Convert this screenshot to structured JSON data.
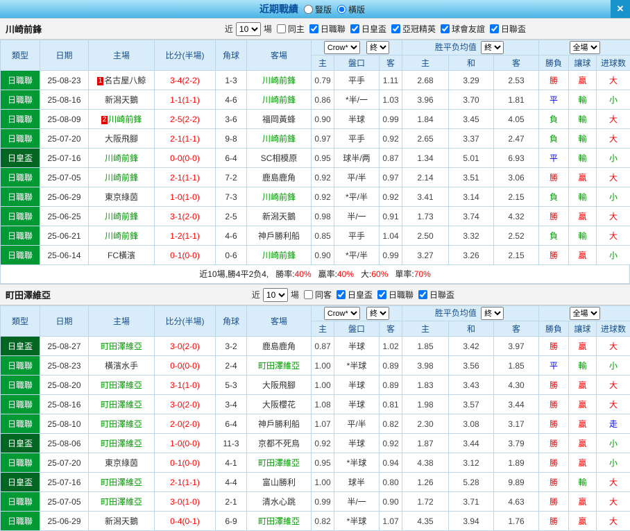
{
  "topbar": {
    "title": "近期戰績",
    "radios": [
      {
        "label": "豎版",
        "selected": false
      },
      {
        "label": "橫版",
        "selected": true
      }
    ],
    "close": "✕"
  },
  "table_header": {
    "type": "類型",
    "date": "日期",
    "home": "主場",
    "score": "比分(半場)",
    "corner": "角球",
    "away": "客場",
    "bookmaker": "Crow*",
    "final": "終",
    "europe": "胜平负均值",
    "fullgame": "全場",
    "ah_sub": [
      "主",
      "盤口",
      "客"
    ],
    "eu_sub": [
      "主",
      "和",
      "客"
    ],
    "res_sub": [
      "勝負",
      "讓球",
      "进球数"
    ]
  },
  "colors": {
    "league_main": "#009933",
    "league_cup": "#006622",
    "win": "#ff0000",
    "draw": "#0000ee",
    "lose": "#009900"
  },
  "sections": [
    {
      "team": "川崎前鋒",
      "filters": {
        "near": "近",
        "count": "10",
        "unit": "場",
        "options": [
          {
            "label": "同主",
            "checked": false
          },
          {
            "label": "日職聯",
            "checked": true
          },
          {
            "label": "日皇盃",
            "checked": true
          },
          {
            "label": "亞冠精英",
            "checked": true
          },
          {
            "label": "球會友誼",
            "checked": true
          },
          {
            "label": "日聯盃",
            "checked": true
          }
        ]
      },
      "rows": [
        {
          "league": "日職聯",
          "date": "25-08-23",
          "home": "名古屋八鯨",
          "home_badge": "1",
          "score": "3-4(2-2)",
          "corner": "1-3",
          "away": "川崎前鋒",
          "ah_home": "0.79",
          "handicap": "平手",
          "ah_away": "1.11",
          "eu_home": "2.68",
          "eu_draw": "3.29",
          "eu_away": "2.53",
          "result": "勝",
          "handicap_result": "贏",
          "goals": "大"
        },
        {
          "league": "日職聯",
          "date": "25-08-16",
          "home": "新潟天鵝",
          "score": "1-1(1-1)",
          "corner": "4-6",
          "away": "川崎前鋒",
          "ah_home": "0.86",
          "handicap": "*半/一",
          "ah_away": "1.03",
          "eu_home": "3.96",
          "eu_draw": "3.70",
          "eu_away": "1.81",
          "result": "平",
          "handicap_result": "輸",
          "goals": "小"
        },
        {
          "league": "日職聯",
          "date": "25-08-09",
          "home": "川崎前鋒",
          "home_badge": "2",
          "score": "2-5(2-2)",
          "corner": "3-6",
          "away": "福岡黃蜂",
          "ah_home": "0.90",
          "handicap": "半球",
          "ah_away": "0.99",
          "eu_home": "1.84",
          "eu_draw": "3.45",
          "eu_away": "4.05",
          "result": "負",
          "handicap_result": "輸",
          "goals": "大"
        },
        {
          "league": "日職聯",
          "date": "25-07-20",
          "home": "大阪飛腳",
          "score": "2-1(1-1)",
          "corner": "9-8",
          "away": "川崎前鋒",
          "ah_home": "0.97",
          "handicap": "平手",
          "ah_away": "0.92",
          "eu_home": "2.65",
          "eu_draw": "3.37",
          "eu_away": "2.47",
          "result": "負",
          "handicap_result": "輸",
          "goals": "大"
        },
        {
          "league": "日皇盃",
          "date": "25-07-16",
          "home": "川崎前鋒",
          "score": "0-0(0-0)",
          "corner": "6-4",
          "away": "SC相模原",
          "ah_home": "0.95",
          "handicap": "球半/两",
          "ah_away": "0.87",
          "eu_home": "1.34",
          "eu_draw": "5.01",
          "eu_away": "6.93",
          "result": "平",
          "handicap_result": "輸",
          "goals": "小"
        },
        {
          "league": "日職聯",
          "date": "25-07-05",
          "home": "川崎前鋒",
          "score": "2-1(1-1)",
          "corner": "7-2",
          "away": "鹿島鹿角",
          "ah_home": "0.92",
          "handicap": "平/半",
          "ah_away": "0.97",
          "eu_home": "2.14",
          "eu_draw": "3.51",
          "eu_away": "3.06",
          "result": "勝",
          "handicap_result": "贏",
          "goals": "大"
        },
        {
          "league": "日職聯",
          "date": "25-06-29",
          "home": "東京綠茵",
          "score": "1-0(1-0)",
          "corner": "7-3",
          "away": "川崎前鋒",
          "ah_home": "0.92",
          "handicap": "*平/半",
          "ah_away": "0.92",
          "eu_home": "3.41",
          "eu_draw": "3.14",
          "eu_away": "2.15",
          "result": "負",
          "handicap_result": "輸",
          "goals": "小"
        },
        {
          "league": "日職聯",
          "date": "25-06-25",
          "home": "川崎前鋒",
          "score": "3-1(2-0)",
          "corner": "2-5",
          "away": "新潟天鵝",
          "ah_home": "0.98",
          "handicap": "半/一",
          "ah_away": "0.91",
          "eu_home": "1.73",
          "eu_draw": "3.74",
          "eu_away": "4.32",
          "result": "勝",
          "handicap_result": "贏",
          "goals": "大"
        },
        {
          "league": "日職聯",
          "date": "25-06-21",
          "home": "川崎前鋒",
          "score": "1-2(1-1)",
          "corner": "4-6",
          "away": "神戶勝利船",
          "ah_home": "0.85",
          "handicap": "平手",
          "ah_away": "1.04",
          "eu_home": "2.50",
          "eu_draw": "3.32",
          "eu_away": "2.52",
          "result": "負",
          "handicap_result": "輸",
          "goals": "大"
        },
        {
          "league": "日職聯",
          "date": "25-06-14",
          "home": "FC橫濱",
          "score": "0-1(0-0)",
          "corner": "0-6",
          "away": "川崎前鋒",
          "ah_home": "0.90",
          "handicap": "*平/半",
          "ah_away": "0.99",
          "eu_home": "3.27",
          "eu_draw": "3.26",
          "eu_away": "2.15",
          "result": "勝",
          "handicap_result": "贏",
          "goals": "小"
        }
      ],
      "summary": {
        "prefix": "近10場,勝4平2负4,",
        "stats": [
          {
            "label": "勝率:",
            "value": "40%"
          },
          {
            "label": "贏率:",
            "value": "40%"
          },
          {
            "label": "大:",
            "value": "60%"
          },
          {
            "label": "單率:",
            "value": "70%"
          }
        ]
      }
    },
    {
      "team": "町田澤維亞",
      "filters": {
        "near": "近",
        "count": "10",
        "unit": "場",
        "options": [
          {
            "label": "同客",
            "checked": false
          },
          {
            "label": "日皇盃",
            "checked": true
          },
          {
            "label": "日職聯",
            "checked": true
          },
          {
            "label": "日聯盃",
            "checked": true
          }
        ]
      },
      "rows": [
        {
          "league": "日皇盃",
          "date": "25-08-27",
          "home": "町田澤維亞",
          "score": "3-0(2-0)",
          "corner": "3-2",
          "away": "鹿島鹿角",
          "ah_home": "0.87",
          "handicap": "半球",
          "ah_away": "1.02",
          "eu_home": "1.85",
          "eu_draw": "3.42",
          "eu_away": "3.97",
          "result": "勝",
          "handicap_result": "贏",
          "goals": "大"
        },
        {
          "league": "日職聯",
          "date": "25-08-23",
          "home": "橫濱水手",
          "score": "0-0(0-0)",
          "corner": "2-4",
          "away": "町田澤維亞",
          "ah_home": "1.00",
          "handicap": "*半球",
          "ah_away": "0.89",
          "eu_home": "3.98",
          "eu_draw": "3.56",
          "eu_away": "1.85",
          "result": "平",
          "handicap_result": "輸",
          "goals": "小"
        },
        {
          "league": "日職聯",
          "date": "25-08-20",
          "home": "町田澤維亞",
          "score": "3-1(1-0)",
          "corner": "5-3",
          "away": "大阪飛腳",
          "ah_home": "1.00",
          "handicap": "半球",
          "ah_away": "0.89",
          "eu_home": "1.83",
          "eu_draw": "3.43",
          "eu_away": "4.30",
          "result": "勝",
          "handicap_result": "贏",
          "goals": "大"
        },
        {
          "league": "日職聯",
          "date": "25-08-16",
          "home": "町田澤維亞",
          "score": "3-0(2-0)",
          "corner": "3-4",
          "away": "大阪櫻花",
          "ah_home": "1.08",
          "handicap": "半球",
          "ah_away": "0.81",
          "eu_home": "1.98",
          "eu_draw": "3.57",
          "eu_away": "3.44",
          "result": "勝",
          "handicap_result": "贏",
          "goals": "大"
        },
        {
          "league": "日職聯",
          "date": "25-08-10",
          "home": "町田澤維亞",
          "score": "2-0(2-0)",
          "corner": "6-4",
          "away": "神戶勝利船",
          "ah_home": "1.07",
          "handicap": "平/半",
          "ah_away": "0.82",
          "eu_home": "2.30",
          "eu_draw": "3.08",
          "eu_away": "3.17",
          "result": "勝",
          "handicap_result": "贏",
          "goals": "走"
        },
        {
          "league": "日皇盃",
          "date": "25-08-06",
          "home": "町田澤維亞",
          "score": "1-0(0-0)",
          "corner": "11-3",
          "away": "京都不死鳥",
          "ah_home": "0.92",
          "handicap": "半球",
          "ah_away": "0.92",
          "eu_home": "1.87",
          "eu_draw": "3.44",
          "eu_away": "3.79",
          "result": "勝",
          "handicap_result": "贏",
          "goals": "小"
        },
        {
          "league": "日職聯",
          "date": "25-07-20",
          "home": "東京綠茵",
          "score": "0-1(0-0)",
          "corner": "4-1",
          "away": "町田澤維亞",
          "ah_home": "0.95",
          "handicap": "*半球",
          "ah_away": "0.94",
          "eu_home": "4.38",
          "eu_draw": "3.12",
          "eu_away": "1.89",
          "result": "勝",
          "handicap_result": "贏",
          "goals": "小"
        },
        {
          "league": "日皇盃",
          "date": "25-07-16",
          "home": "町田澤維亞",
          "score": "2-1(1-1)",
          "corner": "4-4",
          "away": "富山勝利",
          "ah_home": "1.00",
          "handicap": "球半",
          "ah_away": "0.80",
          "eu_home": "1.26",
          "eu_draw": "5.28",
          "eu_away": "9.89",
          "result": "勝",
          "handicap_result": "輸",
          "goals": "大"
        },
        {
          "league": "日職聯",
          "date": "25-07-05",
          "home": "町田澤維亞",
          "score": "3-0(1-0)",
          "corner": "2-1",
          "away": "清水心跳",
          "ah_home": "0.99",
          "handicap": "半/一",
          "ah_away": "0.90",
          "eu_home": "1.72",
          "eu_draw": "3.71",
          "eu_away": "4.63",
          "result": "勝",
          "handicap_result": "贏",
          "goals": "大"
        },
        {
          "league": "日職聯",
          "date": "25-06-29",
          "home": "新潟天鵝",
          "score": "0-4(0-1)",
          "corner": "6-9",
          "away": "町田澤維亞",
          "ah_home": "0.82",
          "handicap": "*半球",
          "ah_away": "1.07",
          "eu_home": "4.35",
          "eu_draw": "3.94",
          "eu_away": "1.76",
          "result": "勝",
          "handicap_result": "贏",
          "goals": "大"
        }
      ]
    }
  ]
}
